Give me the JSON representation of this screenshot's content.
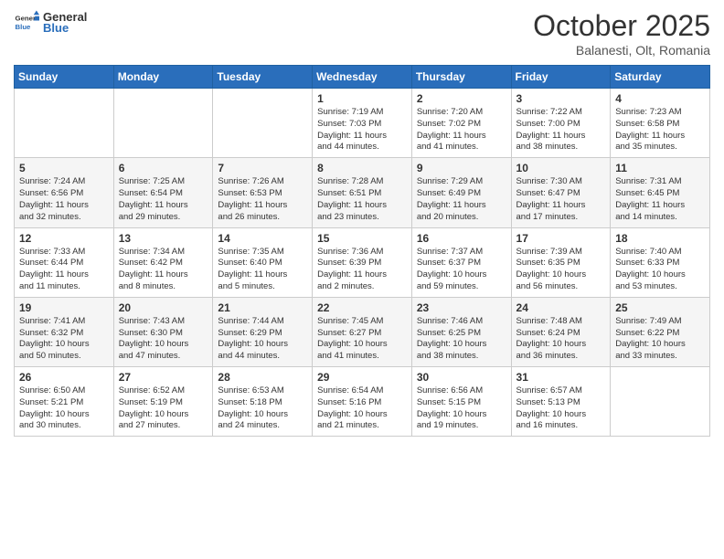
{
  "header": {
    "logo_general": "General",
    "logo_blue": "Blue",
    "title": "October 2025",
    "location": "Balanesti, Olt, Romania"
  },
  "weekdays": [
    "Sunday",
    "Monday",
    "Tuesday",
    "Wednesday",
    "Thursday",
    "Friday",
    "Saturday"
  ],
  "weeks": [
    [
      {
        "day": "",
        "info": ""
      },
      {
        "day": "",
        "info": ""
      },
      {
        "day": "",
        "info": ""
      },
      {
        "day": "1",
        "info": "Sunrise: 7:19 AM\nSunset: 7:03 PM\nDaylight: 11 hours\nand 44 minutes."
      },
      {
        "day": "2",
        "info": "Sunrise: 7:20 AM\nSunset: 7:02 PM\nDaylight: 11 hours\nand 41 minutes."
      },
      {
        "day": "3",
        "info": "Sunrise: 7:22 AM\nSunset: 7:00 PM\nDaylight: 11 hours\nand 38 minutes."
      },
      {
        "day": "4",
        "info": "Sunrise: 7:23 AM\nSunset: 6:58 PM\nDaylight: 11 hours\nand 35 minutes."
      }
    ],
    [
      {
        "day": "5",
        "info": "Sunrise: 7:24 AM\nSunset: 6:56 PM\nDaylight: 11 hours\nand 32 minutes."
      },
      {
        "day": "6",
        "info": "Sunrise: 7:25 AM\nSunset: 6:54 PM\nDaylight: 11 hours\nand 29 minutes."
      },
      {
        "day": "7",
        "info": "Sunrise: 7:26 AM\nSunset: 6:53 PM\nDaylight: 11 hours\nand 26 minutes."
      },
      {
        "day": "8",
        "info": "Sunrise: 7:28 AM\nSunset: 6:51 PM\nDaylight: 11 hours\nand 23 minutes."
      },
      {
        "day": "9",
        "info": "Sunrise: 7:29 AM\nSunset: 6:49 PM\nDaylight: 11 hours\nand 20 minutes."
      },
      {
        "day": "10",
        "info": "Sunrise: 7:30 AM\nSunset: 6:47 PM\nDaylight: 11 hours\nand 17 minutes."
      },
      {
        "day": "11",
        "info": "Sunrise: 7:31 AM\nSunset: 6:45 PM\nDaylight: 11 hours\nand 14 minutes."
      }
    ],
    [
      {
        "day": "12",
        "info": "Sunrise: 7:33 AM\nSunset: 6:44 PM\nDaylight: 11 hours\nand 11 minutes."
      },
      {
        "day": "13",
        "info": "Sunrise: 7:34 AM\nSunset: 6:42 PM\nDaylight: 11 hours\nand 8 minutes."
      },
      {
        "day": "14",
        "info": "Sunrise: 7:35 AM\nSunset: 6:40 PM\nDaylight: 11 hours\nand 5 minutes."
      },
      {
        "day": "15",
        "info": "Sunrise: 7:36 AM\nSunset: 6:39 PM\nDaylight: 11 hours\nand 2 minutes."
      },
      {
        "day": "16",
        "info": "Sunrise: 7:37 AM\nSunset: 6:37 PM\nDaylight: 10 hours\nand 59 minutes."
      },
      {
        "day": "17",
        "info": "Sunrise: 7:39 AM\nSunset: 6:35 PM\nDaylight: 10 hours\nand 56 minutes."
      },
      {
        "day": "18",
        "info": "Sunrise: 7:40 AM\nSunset: 6:33 PM\nDaylight: 10 hours\nand 53 minutes."
      }
    ],
    [
      {
        "day": "19",
        "info": "Sunrise: 7:41 AM\nSunset: 6:32 PM\nDaylight: 10 hours\nand 50 minutes."
      },
      {
        "day": "20",
        "info": "Sunrise: 7:43 AM\nSunset: 6:30 PM\nDaylight: 10 hours\nand 47 minutes."
      },
      {
        "day": "21",
        "info": "Sunrise: 7:44 AM\nSunset: 6:29 PM\nDaylight: 10 hours\nand 44 minutes."
      },
      {
        "day": "22",
        "info": "Sunrise: 7:45 AM\nSunset: 6:27 PM\nDaylight: 10 hours\nand 41 minutes."
      },
      {
        "day": "23",
        "info": "Sunrise: 7:46 AM\nSunset: 6:25 PM\nDaylight: 10 hours\nand 38 minutes."
      },
      {
        "day": "24",
        "info": "Sunrise: 7:48 AM\nSunset: 6:24 PM\nDaylight: 10 hours\nand 36 minutes."
      },
      {
        "day": "25",
        "info": "Sunrise: 7:49 AM\nSunset: 6:22 PM\nDaylight: 10 hours\nand 33 minutes."
      }
    ],
    [
      {
        "day": "26",
        "info": "Sunrise: 6:50 AM\nSunset: 5:21 PM\nDaylight: 10 hours\nand 30 minutes."
      },
      {
        "day": "27",
        "info": "Sunrise: 6:52 AM\nSunset: 5:19 PM\nDaylight: 10 hours\nand 27 minutes."
      },
      {
        "day": "28",
        "info": "Sunrise: 6:53 AM\nSunset: 5:18 PM\nDaylight: 10 hours\nand 24 minutes."
      },
      {
        "day": "29",
        "info": "Sunrise: 6:54 AM\nSunset: 5:16 PM\nDaylight: 10 hours\nand 21 minutes."
      },
      {
        "day": "30",
        "info": "Sunrise: 6:56 AM\nSunset: 5:15 PM\nDaylight: 10 hours\nand 19 minutes."
      },
      {
        "day": "31",
        "info": "Sunrise: 6:57 AM\nSunset: 5:13 PM\nDaylight: 10 hours\nand 16 minutes."
      },
      {
        "day": "",
        "info": ""
      }
    ]
  ]
}
